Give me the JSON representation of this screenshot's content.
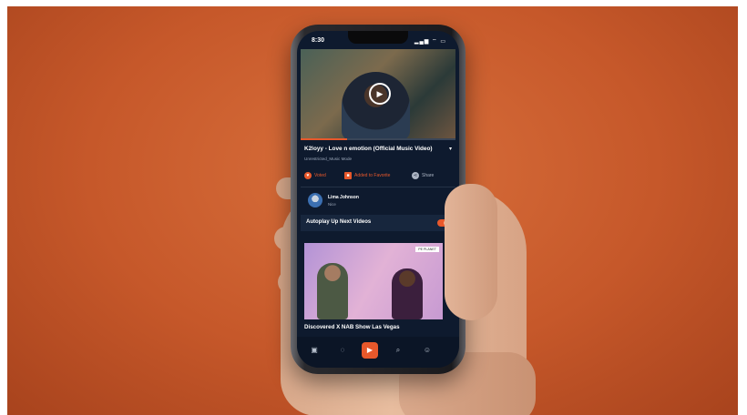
{
  "status_bar": {
    "time": "8:30",
    "icons": "▂▄▆ ⌔ ▭"
  },
  "video": {
    "title": "K2loyy - Love n emotion (Official Music Video)",
    "channel": "Unrestricted_Music Mode",
    "progress_fraction": 0.3
  },
  "actions": [
    {
      "label": "Voted",
      "icon": "heart-icon"
    },
    {
      "label": "Added to Favorite",
      "icon": "bookmark-icon"
    },
    {
      "label": "Share",
      "icon": "share-icon"
    }
  ],
  "comment": {
    "name": "Lima Johnson",
    "text": "Nice"
  },
  "autoplay": {
    "label": "Autoplay Up Next Videos",
    "enabled": true
  },
  "next_video": {
    "title": "Discovered X NAB Show Las Vegas",
    "badge": "PE PLANET"
  },
  "nav": {
    "items": [
      {
        "icon": "library-icon"
      },
      {
        "icon": "chat-icon"
      },
      {
        "icon": "video-icon",
        "active": true
      },
      {
        "icon": "search-icon"
      },
      {
        "icon": "profile-icon"
      }
    ]
  },
  "colors": {
    "accent": "#e8582b",
    "background": "#c6582a",
    "screen": "#0e1a2e"
  }
}
